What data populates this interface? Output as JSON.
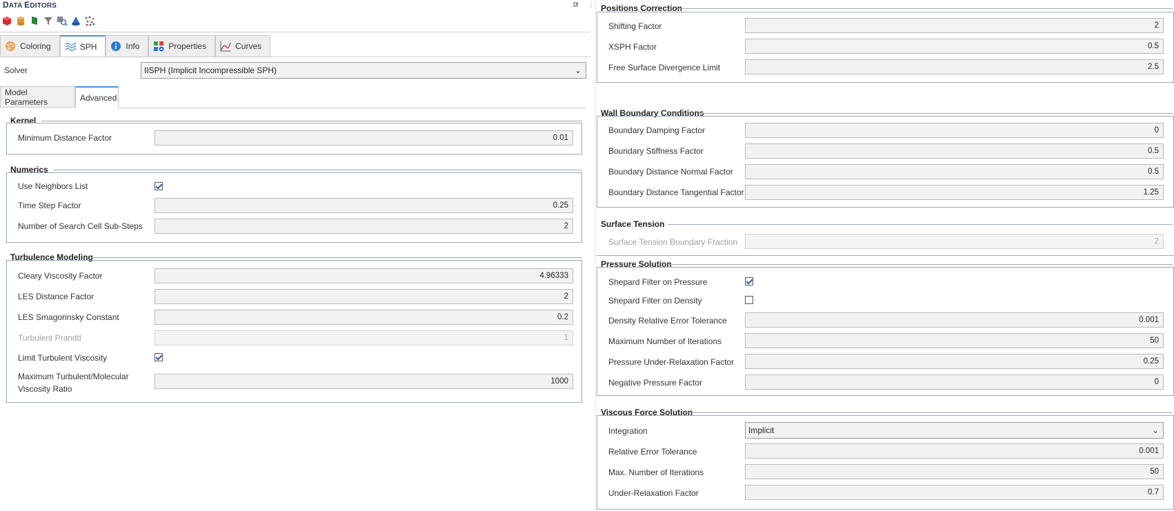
{
  "app": {
    "title_first": "D",
    "title_rest": "ATA ",
    "title_first2": "E",
    "title_rest2": "DITORS"
  },
  "toolbar_icons": [
    "red-cube-icon",
    "orange-cylinder-icon",
    "green-flag-icon",
    "funnel-icon",
    "search-region-icon",
    "blue-cone-icon",
    "particles-icon"
  ],
  "tabs": [
    {
      "label": "Coloring",
      "icon": "palette-icon"
    },
    {
      "label": "SPH",
      "icon": "waves-icon"
    },
    {
      "label": "Info",
      "icon": "info-icon"
    },
    {
      "label": "Properties",
      "icon": "properties-icon"
    },
    {
      "label": "Curves",
      "icon": "curves-icon"
    }
  ],
  "solver": {
    "label": "Solver",
    "value": "IISPH (Implicit Incompressible SPH)"
  },
  "subtabs": [
    "Model Parameters",
    "Advanced"
  ],
  "kernel": {
    "title": "Kernel",
    "min_distance": {
      "label": "Minimum Distance Factor",
      "value": "0.01"
    }
  },
  "numerics": {
    "title": "Numerics",
    "use_neighbors": {
      "label": "Use Neighbors List",
      "checked": true
    },
    "time_step": {
      "label": "Time Step Factor",
      "value": "0.25"
    },
    "search_cell": {
      "label": "Number of Search Cell Sub-Steps",
      "value": "2"
    }
  },
  "turbulence": {
    "title": "Turbulence Modeling",
    "cleary": {
      "label": "Cleary Viscosity Factor",
      "value": "4.96333"
    },
    "les_distance": {
      "label": "LES Distance Factor",
      "value": "2"
    },
    "les_smag": {
      "label": "LES Smagorinsky Constant",
      "value": "0.2"
    },
    "prandtl": {
      "label": "Turbulent Prandtl",
      "value": "1"
    },
    "limit_visc": {
      "label": "Limit Turbulent Viscosity",
      "checked": true
    },
    "max_ratio": {
      "label_line1": "Maximum Turbulent/Molecular",
      "label_line2": "Viscosity Ratio",
      "value": "1000"
    }
  },
  "positions": {
    "title": "Positions Correction",
    "shifting": {
      "label": "Shifting Factor",
      "value": "2"
    },
    "xsph": {
      "label": "XSPH Factor",
      "value": "0.5"
    },
    "free_surface": {
      "label": "Free Surface Divergence Limit",
      "value": "2.5"
    }
  },
  "wall": {
    "title": "Wall Boundary Conditions",
    "damping": {
      "label": "Boundary Damping Factor",
      "value": "0"
    },
    "stiffness": {
      "label": "Boundary Stiffness Factor",
      "value": "0.5"
    },
    "normal": {
      "label": "Boundary Distance Normal Factor",
      "value": "0.5"
    },
    "tangential": {
      "label": "Boundary Distance Tangential Factor",
      "value": "1.25"
    }
  },
  "surface": {
    "title": "Surface Tension",
    "fraction": {
      "label": "Surface Tension Boundary Fraction",
      "value": "2"
    }
  },
  "pressure": {
    "title": "Pressure Solution",
    "shepard_p": {
      "label": "Shepard Filter on Pressure",
      "checked": true
    },
    "shepard_d": {
      "label": "Shepard Filter on Density",
      "checked": false
    },
    "density_tol": {
      "label": "Density Relative Error Tolerance",
      "value": "0.001"
    },
    "max_iter": {
      "label": "Maximum Number of Iterations",
      "value": "50"
    },
    "under_relax": {
      "label": "Pressure Under-Relaxation Factor",
      "value": "0.25"
    },
    "negative": {
      "label": "Negative Pressure Factor",
      "value": "0"
    }
  },
  "viscous": {
    "title": "Viscous Force Solution",
    "integration": {
      "label": "Integration",
      "value": "Implicit"
    },
    "rel_tol": {
      "label": "Relative Error Tolerance",
      "value": "0.001"
    },
    "max_iter": {
      "label": "Max. Number of Iterations",
      "value": "50"
    },
    "under_relax": {
      "label": "Under-Relaxation Factor",
      "value": "0.7"
    }
  }
}
